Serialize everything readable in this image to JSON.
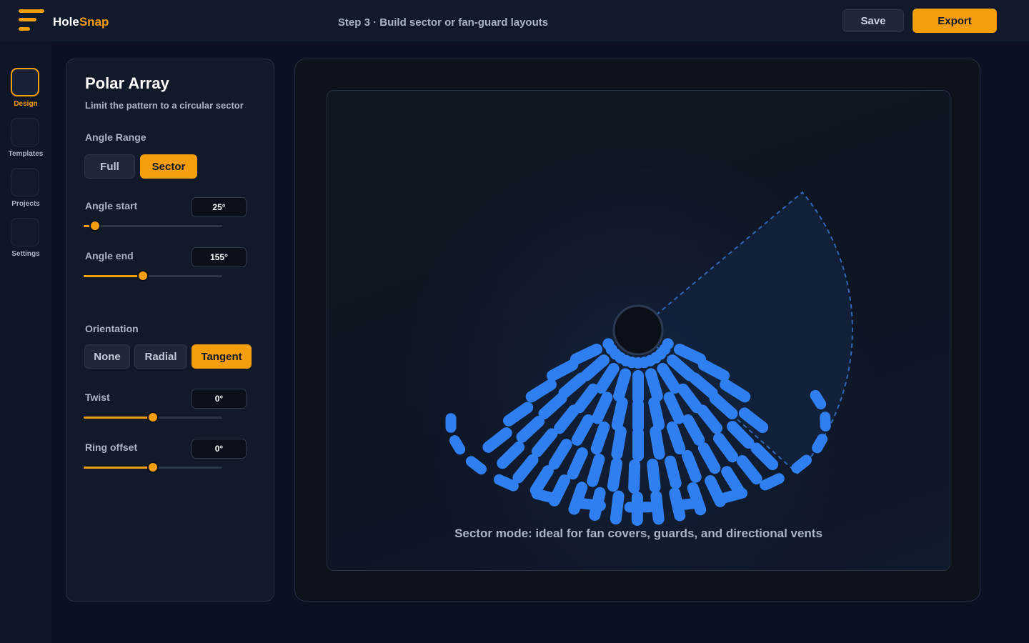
{
  "app": {
    "brand_prefix": "Hole",
    "brand_suffix": "Snap",
    "step_title": "Step 3 · Build sector or fan-guard layouts",
    "save_label": "Save",
    "export_label": "Export",
    "accent_color": "#f59e0b",
    "hole_color": "#2f7ff0"
  },
  "sidebar": {
    "items": [
      {
        "label": "Design",
        "active": true
      },
      {
        "label": "Templates",
        "active": false
      },
      {
        "label": "Projects",
        "active": false
      },
      {
        "label": "Settings",
        "active": false
      }
    ]
  },
  "panel": {
    "title": "Polar Array",
    "subtitle": "Limit the pattern to a circular sector",
    "angle_range": {
      "label": "Angle Range",
      "options": [
        "Full",
        "Sector"
      ],
      "selected": "Sector"
    },
    "angle_start": {
      "label": "Angle start",
      "value": "25°",
      "slider_fraction": 0.08
    },
    "angle_end": {
      "label": "Angle end",
      "value": "155°",
      "slider_fraction": 0.43
    },
    "orientation": {
      "label": "Orientation",
      "options": [
        "None",
        "Radial",
        "Tangent"
      ],
      "selected": "Tangent"
    },
    "twist": {
      "label": "Twist",
      "value": "0°",
      "slider_fraction": 0.5
    },
    "ring_offset": {
      "label": "Ring offset",
      "value": "0°",
      "slider_fraction": 0.5
    }
  },
  "preview": {
    "caption": "Sector mode: ideal for fan covers, guards, and directional vents"
  }
}
